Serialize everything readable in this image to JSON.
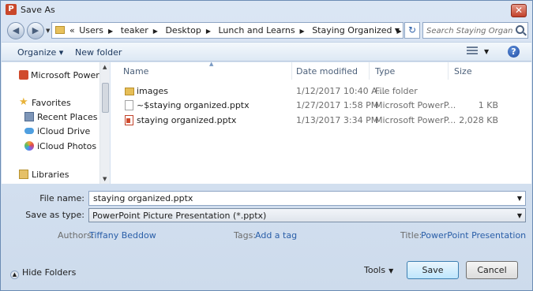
{
  "window": {
    "title": "Save As",
    "app_icon_letter": "P"
  },
  "address": {
    "crumbs": [
      "Users",
      "teaker",
      "Desktop",
      "Lunch and Learns",
      "Staying Organized"
    ],
    "lead": "«"
  },
  "search": {
    "placeholder": "Search Staying Organiz..."
  },
  "toolbar": {
    "organize_label": "Organize ▾",
    "new_folder_label": "New folder"
  },
  "nav_pane": {
    "items": [
      {
        "label": "Microsoft PowerPoint",
        "icon": "powerpoint-icon"
      },
      {
        "label": "Favorites",
        "icon": "star-icon"
      },
      {
        "label": "Recent Places",
        "icon": "recent-places-icon"
      },
      {
        "label": "iCloud Drive",
        "icon": "icloud-icon"
      },
      {
        "label": "iCloud Photos",
        "icon": "icloud-photos-icon"
      },
      {
        "label": "Libraries",
        "icon": "libraries-icon"
      }
    ]
  },
  "file_list": {
    "columns": [
      "Name",
      "Date modified",
      "Type",
      "Size"
    ],
    "rows": [
      {
        "name": "images",
        "date": "1/12/2017 10:40 A...",
        "type": "File folder",
        "size": "",
        "icon": "folder-icon"
      },
      {
        "name": "~$staying organized.pptx",
        "date": "1/27/2017 1:58 PM",
        "type": "Microsoft PowerP...",
        "size": "1 KB",
        "icon": "temp-file-icon"
      },
      {
        "name": "staying organized.pptx",
        "date": "1/13/2017 3:34 PM",
        "type": "Microsoft PowerP...",
        "size": "2,028 KB",
        "icon": "pptx-file-icon"
      }
    ]
  },
  "fields": {
    "file_name_label": "File name:",
    "file_name_value": "staying organized.pptx",
    "save_type_label": "Save as type:",
    "save_type_value": "PowerPoint Picture Presentation (*.pptx)"
  },
  "meta": {
    "authors_label": "Authors:",
    "authors_value": "Tiffany Beddow",
    "tags_label": "Tags:",
    "tags_value": "Add a tag",
    "title_label": "Title:",
    "title_value": "PowerPoint Presentation"
  },
  "footer": {
    "hide_folders_label": "Hide Folders",
    "tools_label": "Tools",
    "save_label": "Save",
    "cancel_label": "Cancel"
  }
}
